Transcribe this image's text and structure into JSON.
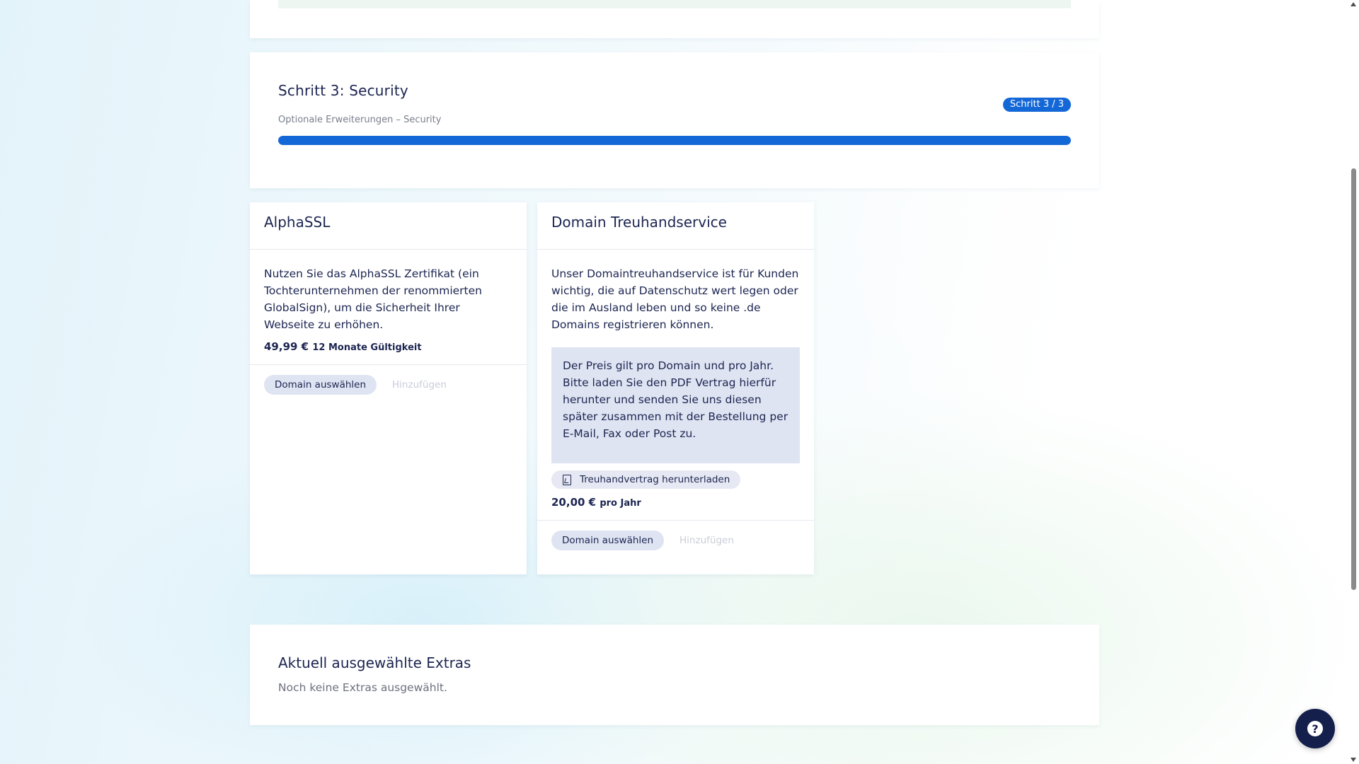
{
  "step": {
    "title": "Schritt 3: Security",
    "subtitle": "Optionale Erweiterungen – Security",
    "badge": "Schritt 3 / 3",
    "progress": 1.0
  },
  "cards": [
    {
      "title": "AlphaSSL",
      "description": "Nutzen Sie das AlphaSSL Zertifikat (ein Tochterunternehmen der renommierten GlobalSign), um die Sicherheit Ihrer Webseite zu erhöhen.",
      "price": "49,99 €",
      "price_unit": "12 Monate Gültigkeit",
      "select_label": "Domain auswählen",
      "add_label": "Hinzufügen"
    },
    {
      "title": "Domain Treuhandservice",
      "description": "Unser Domaintreuhandservice ist für Kunden wichtig, die auf Datenschutz wert legen oder die im Ausland leben und so keine .de Domains registrieren können.",
      "info": "Der Preis gilt pro Domain und pro Jahr. Bitte laden Sie den PDF Vertrag hierfür herunter und senden Sie uns diesen später zusammen mit der Bestellung per E-Mail, Fax oder Post zu.",
      "download_label": "Treuhandvertrag herunterladen",
      "price": "20,00 €",
      "price_unit": "pro Jahr",
      "select_label": "Domain auswählen",
      "add_label": "Hinzufügen"
    }
  ],
  "extras": {
    "title": "Aktuell ausgewählte Extras",
    "empty_text": "Noch keine Extras ausgewählt."
  },
  "help": {
    "icon": "question-icon",
    "label": "?"
  },
  "colors": {
    "accent": "#1467d6",
    "navy": "#1c2551",
    "pill_bg": "#dfe4f2",
    "help_bg": "#141f4c"
  }
}
